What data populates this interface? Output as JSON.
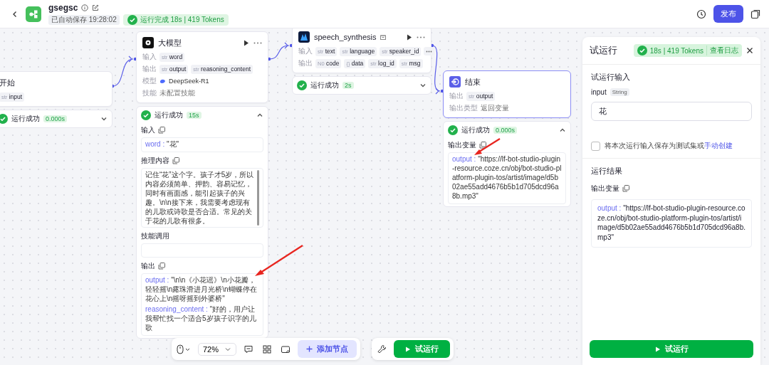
{
  "header": {
    "app_name": "gsegsc",
    "autosave": "已自动保存 19:28:02",
    "run_status": "运行完成 18s | 419 Tokens",
    "publish_button": "发布"
  },
  "nodes": [
    {
      "kind": "start",
      "title": "开始",
      "selected": false,
      "rows": [
        {
          "kind": "tags",
          "tags": [
            {
              "name": "input",
              "type": "str"
            }
          ]
        }
      ],
      "result": {
        "status": "运行成功",
        "time": "0.000s",
        "expanded": false
      }
    },
    {
      "kind": "llm",
      "title": "大模型",
      "selected": false,
      "rows": [
        {
          "kind": "tags",
          "label": "输入",
          "tags": [
            {
              "name": "word",
              "type": "str"
            }
          ]
        },
        {
          "kind": "tags",
          "label": "输出",
          "tags": [
            {
              "name": "output",
              "type": "str"
            },
            {
              "name": "reasoning_content",
              "type": "str"
            }
          ]
        },
        {
          "kind": "model",
          "label": "模型",
          "text": "DeepSeek-R1"
        },
        {
          "kind": "text",
          "label": "技能",
          "text": "未配置技能"
        }
      ],
      "result": {
        "status": "运行成功",
        "time": "15s",
        "expanded": true,
        "sections": [
          {
            "kind": "values",
            "title": "输入",
            "copyable": true,
            "arrow": false,
            "entries": [
              {
                "key": "word :",
                "value": "\"花\""
              }
            ]
          },
          {
            "kind": "text",
            "title": "推理内容",
            "copyable": true,
            "text": "记住“花”这个字。孩子才5岁，所以内容必须简单、押韵、容易记忆，同时有画面感，能引起孩子的兴趣。\\n\\n接下来，我需要考虑现有的儿歌或诗歌是否合适。常见的关于花的儿歌有很多。"
          },
          {
            "kind": "empty",
            "title": "技能调用",
            "copyable": false
          },
          {
            "kind": "values",
            "title": "输出",
            "copyable": true,
            "arrow": true,
            "entries": [
              {
                "key": "output :",
                "value": "\"\\n\\n《小花谣》\\n小花瓣，轻轻摇\\n露珠滑进月光桥\\n蝴蝶停在花心上\\n摇呀摇到外婆桥\""
              },
              {
                "key": "reasoning_content :",
                "value": "\"好的，用户让我帮忙找一个适合5岁孩子识字的儿歌"
              }
            ]
          }
        ]
      }
    },
    {
      "kind": "plugin",
      "title": "speech_synthesis",
      "selected": false,
      "rows": [
        {
          "kind": "tags",
          "label": "输入",
          "more": true,
          "tags": [
            {
              "name": "text",
              "type": "str"
            },
            {
              "name": "language",
              "type": "str"
            },
            {
              "name": "speaker_id",
              "type": "str"
            }
          ]
        },
        {
          "kind": "tags",
          "label": "输出",
          "more": false,
          "tags": [
            {
              "name": "code",
              "type": "N0"
            },
            {
              "name": "data",
              "type": "{}"
            },
            {
              "name": "log_id",
              "type": "str"
            },
            {
              "name": "msg",
              "type": "str"
            }
          ]
        }
      ],
      "result": {
        "status": "运行成功",
        "time": "2s",
        "expanded": false
      }
    },
    {
      "kind": "end",
      "title": "结束",
      "selected": true,
      "rows": [
        {
          "kind": "tags",
          "label": "输出",
          "tags": [
            {
              "name": "output",
              "type": "str"
            }
          ]
        },
        {
          "kind": "text",
          "label": "输出类型",
          "text": "返回变量"
        }
      ],
      "result": {
        "status": "运行成功",
        "time": "0.000s",
        "expanded": true,
        "sections": [
          {
            "kind": "values",
            "title": "输出变量",
            "copyable": true,
            "arrow": true,
            "entries": [
              {
                "key": "output :",
                "value": "\"https://lf-bot-studio-plugin-resource.coze.cn/obj/bot-studio-platform-plugin-tos/artist/image/d5b02ae55add4676b5b1d705dcd96a8b.mp3\""
              }
            ]
          }
        ]
      }
    }
  ],
  "test_run": {
    "title": "试运行",
    "stats": "18s | 419 Tokens",
    "log_link": "查看日志",
    "input_section": "试运行输入",
    "param": {
      "name": "input",
      "type": "String",
      "value": "花"
    },
    "save_checkbox": {
      "label": "将本次运行输入保存为测试集或",
      "link": "手动创建",
      "checked": false
    },
    "result_section": "运行结果",
    "output_title": "输出变量",
    "output": {
      "key": "output :",
      "value": "\"https://lf-bot-studio-plugin-resource.coze.cn/obj/bot-studio-platform-plugin-tos/artist/image/d5b02ae55add4676b5b1d705dcd96a8b.mp3\""
    },
    "run_button": "试运行"
  },
  "toolbar": {
    "zoom": "72%",
    "add_node_button": "添加节点",
    "run_button": "试运行"
  }
}
